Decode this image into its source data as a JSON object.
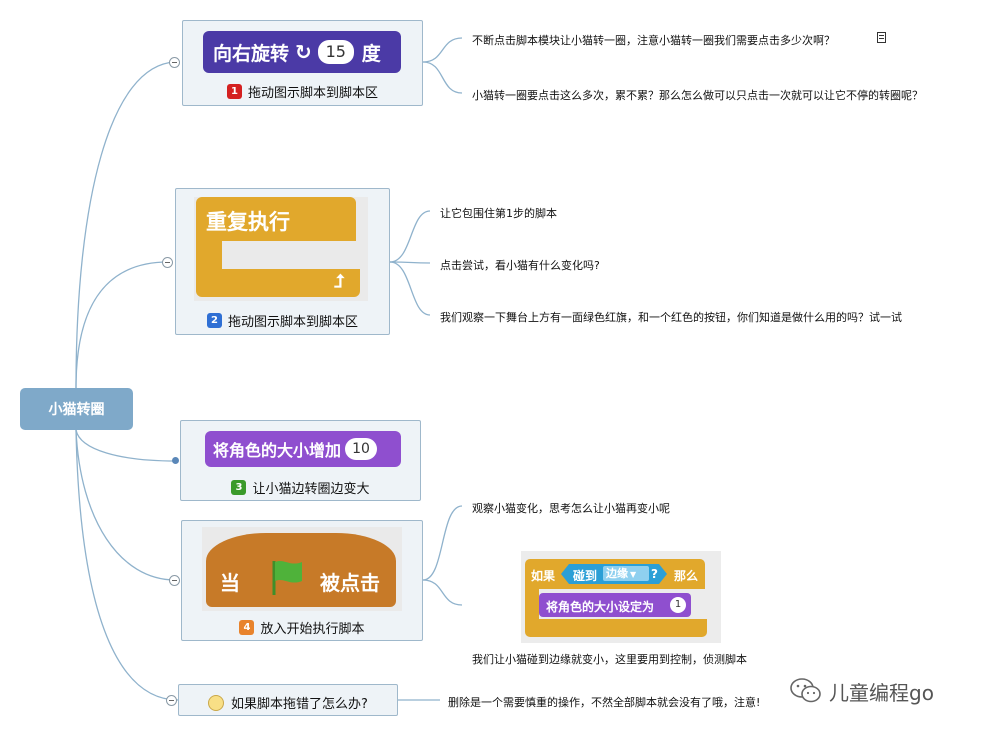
{
  "root": {
    "label": "小猫转圈"
  },
  "nodes": [
    {
      "caption": "拖动图示脚本到脚本区",
      "step": "1",
      "step_color": "#d42020",
      "block": {
        "text": "向右旋转",
        "value": "15",
        "unit": "度",
        "color": "#4b3aa6",
        "icon": "rotate-clockwise-icon"
      },
      "notes": [
        "不断点击脚本模块让小猫转一圈，注意小猫转一圈我们需要点击多少次啊？",
        "小猫转一圈要点击这么多次，累不累？那么怎么做可以只点击一次就可以让它不停的转圈呢？"
      ]
    },
    {
      "caption": "拖动图示脚本到脚本区",
      "step": "2",
      "step_color": "#2f6fd4",
      "block": {
        "text": "重复执行",
        "color": "#e1a82c",
        "icon": "loop-arrow-icon"
      },
      "notes": [
        "让它包围住第1步的脚本",
        "点击尝试，看小猫有什么变化吗?",
        "我们观察一下舞台上方有一面绿色红旗，和一个红色的按钮，你们知道是做什么用的吗？试一试"
      ]
    },
    {
      "caption": "让小猫边转圈边变大",
      "step": "3",
      "step_color": "#3a9a2a",
      "block": {
        "text": "将角色的大小增加",
        "value": "10",
        "color": "#8f4fcf"
      }
    },
    {
      "caption": "放入开始执行脚本",
      "step": "4",
      "step_color": "#e8832c",
      "block": {
        "text_before": "当",
        "text_after": "被点击",
        "color": "#c77a28",
        "icon": "green-flag-icon"
      },
      "notes": [
        "观察小猫变化，思考怎么让小猫再变小呢",
        "我们让小猫碰到边缘就变小，这里要用到控制，侦测脚本"
      ],
      "sub_block": {
        "if_label": "如果",
        "touching_label": "碰到",
        "edge_label": "边缘",
        "question": "?",
        "then_label": "那么",
        "set_size_label": "将角色的大小设定为",
        "set_size_value": "1"
      }
    },
    {
      "caption": "如果脚本拖错了怎么办?",
      "icon": "yellow-circle-icon",
      "notes": [
        "删除是一个需要慎重的操作，不然全部脚本就会没有了哦，注意!"
      ]
    }
  ],
  "watermark": {
    "text": "儿童编程go",
    "icon": "wechat-icon"
  }
}
